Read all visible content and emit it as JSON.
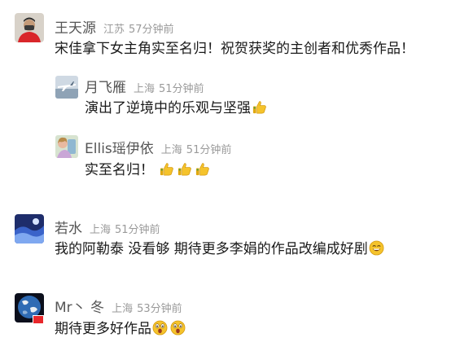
{
  "comments": [
    {
      "name": "王天源",
      "location": "江苏",
      "time": "57分钟前",
      "text": "宋佳拿下女主角实至名归！祝贺获奖的主创者和优秀作品！",
      "emojis": [],
      "avatar_icon": "person-red-jersey-avatar",
      "replies": [
        {
          "name": "月飞雁",
          "location": "上海",
          "time": "51分钟前",
          "text": "演出了逆境中的乐观与坚强",
          "emojis": [
            "thumbs-up"
          ],
          "avatar_icon": "airplane-avatar"
        },
        {
          "name": "Ellis瑶伊依",
          "location": "上海",
          "time": "51分钟前",
          "text": "实至名归！",
          "emojis": [
            "thumbs-up",
            "thumbs-up",
            "thumbs-up"
          ],
          "avatar_icon": "illustration-avatar"
        }
      ]
    },
    {
      "name": "若水",
      "location": "上海",
      "time": "51分钟前",
      "text": "我的阿勒泰 没看够 期待更多李娟的作品改编成好剧",
      "emojis": [
        "grinning-face"
      ],
      "avatar_icon": "blue-wave-avatar"
    },
    {
      "name": "Mr丶 冬",
      "location": "上海",
      "time": "53分钟前",
      "text": "期待更多好作品",
      "emojis": [
        "surprised-face",
        "surprised-face"
      ],
      "avatar_icon": "earth-avatar"
    }
  ],
  "colors": {
    "name": "#555555",
    "meta": "#9a9a9a",
    "text": "#1a1a1a",
    "emoji_yellow": "#f5c32c"
  }
}
